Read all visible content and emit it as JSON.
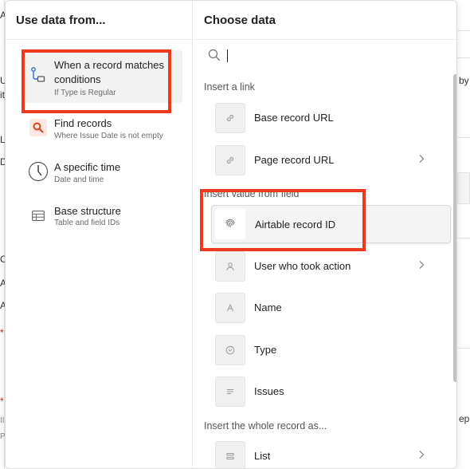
{
  "background": {
    "left_fragments": [
      "A",
      "U",
      "it",
      "L",
      "D",
      "C",
      "A",
      "A",
      "*",
      "*",
      "II",
      "P"
    ],
    "right_fragments": [
      "by",
      "ep"
    ]
  },
  "left_pane": {
    "title": "Use data from...",
    "items": [
      {
        "label": "When a record matches conditions",
        "sub": "If Type is Regular",
        "icon": "trigger-flow-icon",
        "selected": true
      },
      {
        "label": "Find records",
        "sub": "Where Issue Date is not empty",
        "icon": "search-icon",
        "selected": false
      },
      {
        "label": "A specific time",
        "sub": "Date and time",
        "icon": "clock-icon",
        "selected": false
      },
      {
        "label": "Base structure",
        "sub": "Table and field IDs",
        "icon": "table-icon",
        "selected": false
      }
    ]
  },
  "right_pane": {
    "title": "Choose data",
    "search": {
      "value": "",
      "placeholder": ""
    },
    "sections": {
      "link": "Insert a link",
      "field": "Insert value from field",
      "record": "Insert the whole record as..."
    },
    "options": [
      {
        "label": "Base record URL",
        "icon": "link-icon",
        "chevron": false,
        "selected": false
      },
      {
        "label": "Page record URL",
        "icon": "link-icon",
        "chevron": true,
        "selected": false
      },
      {
        "label": "Airtable record ID",
        "icon": "fingerprint-icon",
        "chevron": false,
        "selected": true
      },
      {
        "label": "User who took action",
        "icon": "user-icon",
        "chevron": true,
        "selected": false
      },
      {
        "label": "Name",
        "icon": "text-field-icon",
        "chevron": false,
        "selected": false
      },
      {
        "label": "Type",
        "icon": "single-select-icon",
        "chevron": false,
        "selected": false
      },
      {
        "label": "Issues",
        "icon": "long-text-icon",
        "chevron": false,
        "selected": false
      },
      {
        "label": "List",
        "icon": "list-icon",
        "chevron": true,
        "selected": false
      }
    ]
  },
  "colors": {
    "annotation": "#ec3a1f",
    "find_records_icon": "#d6451d",
    "trigger_icon": "#2d6fd0"
  }
}
